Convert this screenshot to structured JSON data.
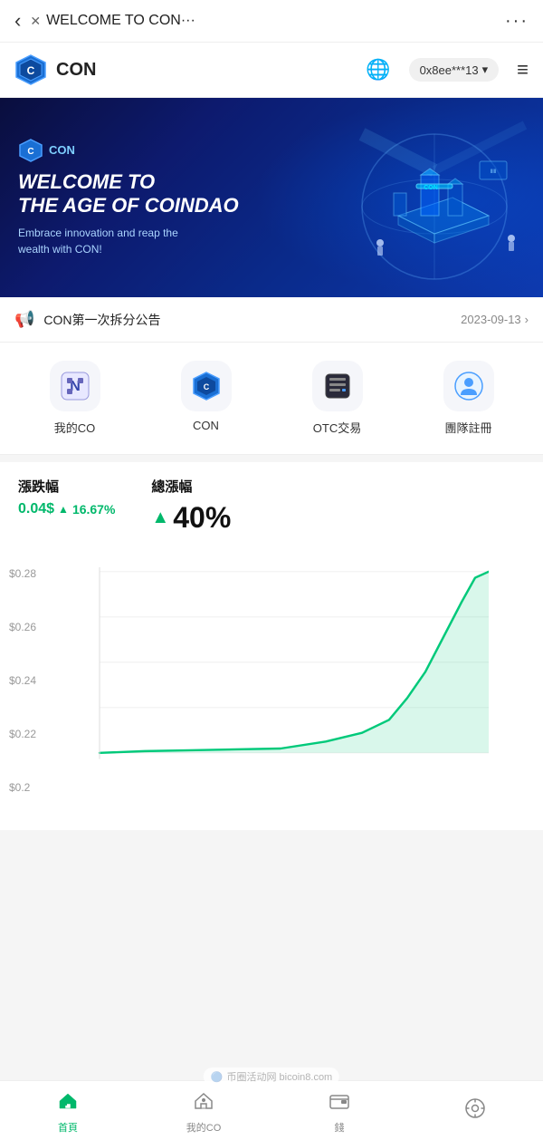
{
  "browser": {
    "back_label": "‹",
    "close_label": "✕",
    "title": "WELCOME TO CON···",
    "more_label": "···"
  },
  "header": {
    "app_name": "CON",
    "globe_icon": "🌐",
    "wallet_address": "0x8ee***13",
    "dropdown_icon": "▾",
    "menu_icon": "≡"
  },
  "banner": {
    "logo_label": "CON",
    "title_line1": "WELCOME TO",
    "title_line2": "THE AGE OF COINDAO",
    "subtitle": "Embrace innovation and reap the wealth with CON!"
  },
  "announcement": {
    "icon": "📢",
    "text": "CON第一次拆分公告",
    "date": "2023-09-13",
    "chevron": "›"
  },
  "quick_actions": [
    {
      "id": "my-co",
      "icon": "N",
      "icon_type": "nfc",
      "label": "我的CO"
    },
    {
      "id": "con",
      "icon": "C",
      "icon_type": "con",
      "label": "CON"
    },
    {
      "id": "otc",
      "icon": "B",
      "icon_type": "book",
      "label": "OTC交易"
    },
    {
      "id": "team",
      "icon": "U",
      "icon_type": "user",
      "label": "團隊註冊"
    }
  ],
  "stats": {
    "change_label": "漲跌幅",
    "change_value": "0.04",
    "change_unit": "$",
    "change_pct_arrow": "▲",
    "change_pct": "16.67%",
    "total_label": "總漲幅",
    "total_arrow": "▲",
    "total_pct": "40%"
  },
  "chart": {
    "y_labels": [
      "$0.28",
      "$0.26",
      "$0.24",
      "$0.22",
      "$0.2"
    ],
    "color": "#00c97a"
  },
  "bottom_nav": [
    {
      "id": "home",
      "icon": "🏠",
      "label": "首頁",
      "active": true
    },
    {
      "id": "my-co",
      "icon": "🏡",
      "label": "我的CO",
      "active": false
    },
    {
      "id": "wallet",
      "icon": "💳",
      "label": "錢",
      "active": false
    },
    {
      "id": "profile",
      "icon": "⚙️",
      "label": "",
      "active": false
    }
  ],
  "watermark": {
    "icon": "🔵",
    "text": "币圈活动网 bicoin8.com"
  }
}
